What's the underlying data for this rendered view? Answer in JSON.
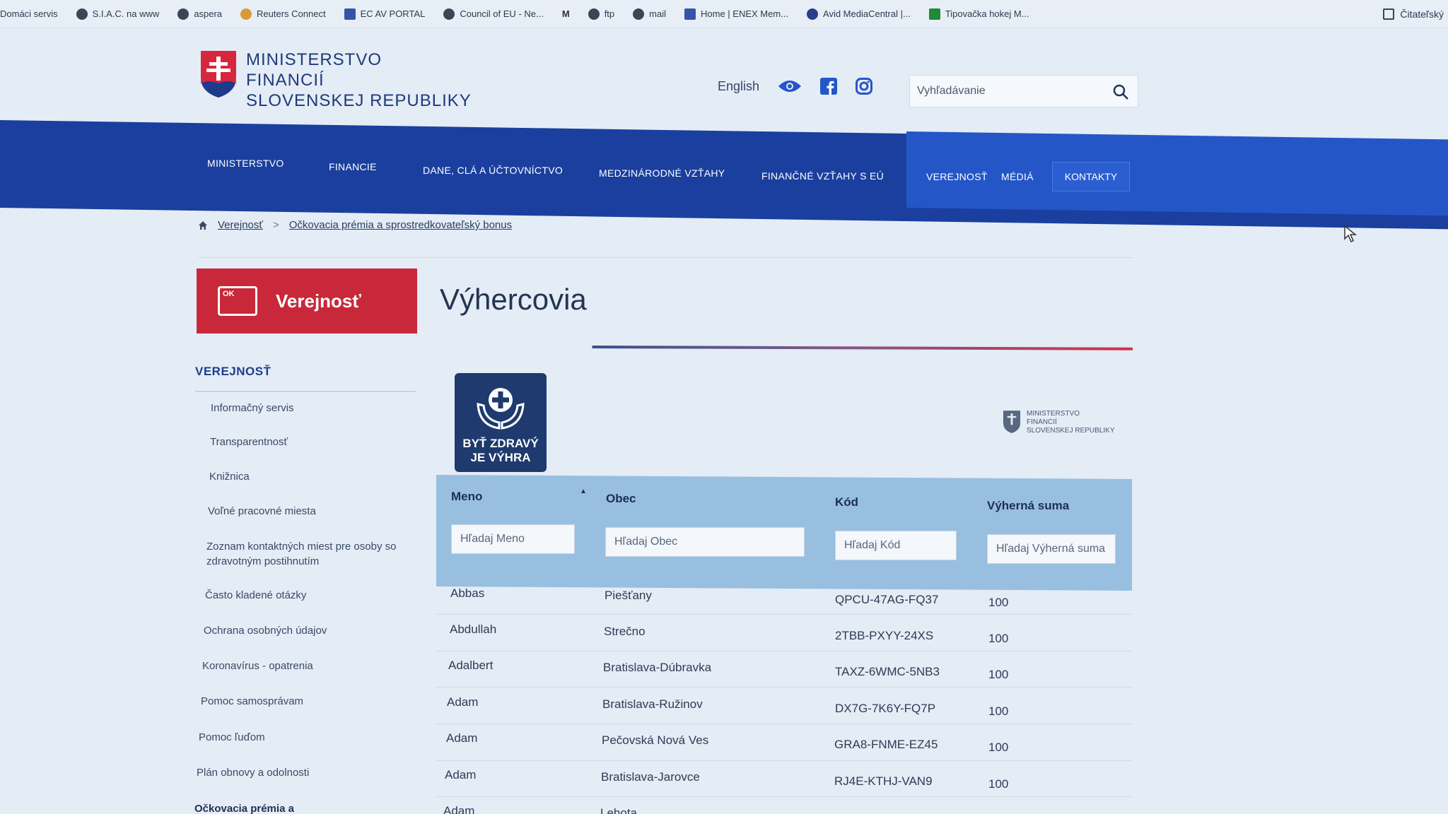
{
  "bookmarks": [
    "Domáci servis",
    "S.I.A.C. na www",
    "aspera",
    "Reuters Connect",
    "EC AV PORTAL",
    "Council of EU - Ne...",
    "ftp",
    "mail",
    "Home | ENEX Mem...",
    "Avid MediaCentral |...",
    "Tipovačka hokej M..."
  ],
  "reader_label": "Čitateľský",
  "header": {
    "logo_lines": [
      "Ministerstvo",
      "financií",
      "Slovenskej republiky"
    ],
    "lang": "English",
    "search_placeholder": "Vyhľadávanie"
  },
  "nav": {
    "items": [
      "Ministerstvo",
      "Financie",
      "Dane, clá a účtovníctvo",
      "Medzinárodné vzťahy",
      "Finančné vzťahy s EÚ"
    ],
    "right_items": [
      "Verejnosť",
      "Médiá"
    ],
    "contact": "Kontakty"
  },
  "breadcrumb": {
    "items": [
      "Verejnosť",
      "Očkovacia prémia a sprostredkovateľský bonus"
    ]
  },
  "sidebar": {
    "card_label": "Verejnosť",
    "card_icon_text": "OK",
    "title": "Verejnosť",
    "items": [
      "Informačný servis",
      "Transparentnosť",
      "Knižnica",
      "Voľné pracovné miesta",
      "Zoznam kontaktných miest pre osoby so zdravotným postihnutím",
      "Často kladené otázky",
      "Ochrana osobných údajov",
      "Koronavírus - opatrenia",
      "Pomoc samosprávam",
      "Pomoc ľuďom",
      "Plán obnovy a odolnosti",
      "Očkovacia prémia a"
    ]
  },
  "main": {
    "title": "Výhercovia",
    "campaign_logo_text": [
      "BYŤ ZDRAVÝ",
      "JE VÝHRA"
    ],
    "mini_logo_lines": [
      "Ministerstvo",
      "financií",
      "Slovenskej republiky"
    ]
  },
  "table": {
    "columns": [
      "Meno",
      "Obec",
      "Kód",
      "Výherná suma"
    ],
    "filters": [
      "Hľadaj Meno",
      "Hľadaj Obec",
      "Hľadaj Kód",
      "Hľadaj Výherná suma"
    ],
    "rows": [
      [
        "Abbas",
        "Piešťany",
        "QPCU-47AG-FQ37",
        "100"
      ],
      [
        "Abdullah",
        "Strečno",
        "2TBB-PXYY-24XS",
        "100"
      ],
      [
        "Adalbert",
        "Bratislava-Dúbravka",
        "TAXZ-6WMC-5NB3",
        "100"
      ],
      [
        "Adam",
        "Bratislava-Ružinov",
        "DX7G-7K6Y-FQ7P",
        "100"
      ],
      [
        "Adam",
        "Pečovská Nová Ves",
        "GRA8-FNME-EZ45",
        "100"
      ],
      [
        "Adam",
        "Bratislava-Jarovce",
        "RJ4E-KTHJ-VAN9",
        "100"
      ],
      [
        "Adam",
        "Lehota",
        "",
        ""
      ]
    ]
  },
  "colors": {
    "nav_dark": "#1a3f9e",
    "nav_light": "#2456c8",
    "accent_red": "#c8283a",
    "table_head": "#98bfe0"
  }
}
